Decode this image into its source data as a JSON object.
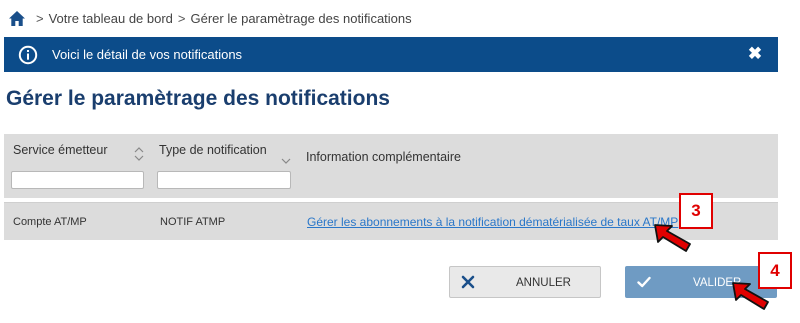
{
  "breadcrumb": {
    "separator": ">",
    "items": [
      "Votre tableau de bord",
      "Gérer le paramètrage des notifications"
    ]
  },
  "banner": {
    "text": "Voici le détail de vos notifications",
    "close_glyph": "✖",
    "color": "#0c4c8a"
  },
  "page": {
    "title": "Gérer le paramètrage des notifications"
  },
  "table": {
    "columns": [
      "Service émetteur",
      "Type de notification",
      "Information complémentaire"
    ],
    "filters": [
      {
        "value": ""
      },
      {
        "value": ""
      }
    ],
    "rows": [
      {
        "service": "Compte AT/MP",
        "type": "NOTIF ATMP",
        "info": "Gérer les abonnements à la notification dématérialisée de taux AT/MP"
      }
    ]
  },
  "buttons": {
    "cancel": "ANNULER",
    "validate": "VALIDER"
  },
  "annotations": {
    "callout_3": "3",
    "callout_4": "4",
    "color": "#e00000"
  },
  "icons": {
    "home": "home-icon",
    "info": "info-icon",
    "close": "close-icon",
    "sort": "sort-icon",
    "cancel": "x-icon",
    "validate": "check-icon",
    "arrow": "arrow-icon"
  }
}
